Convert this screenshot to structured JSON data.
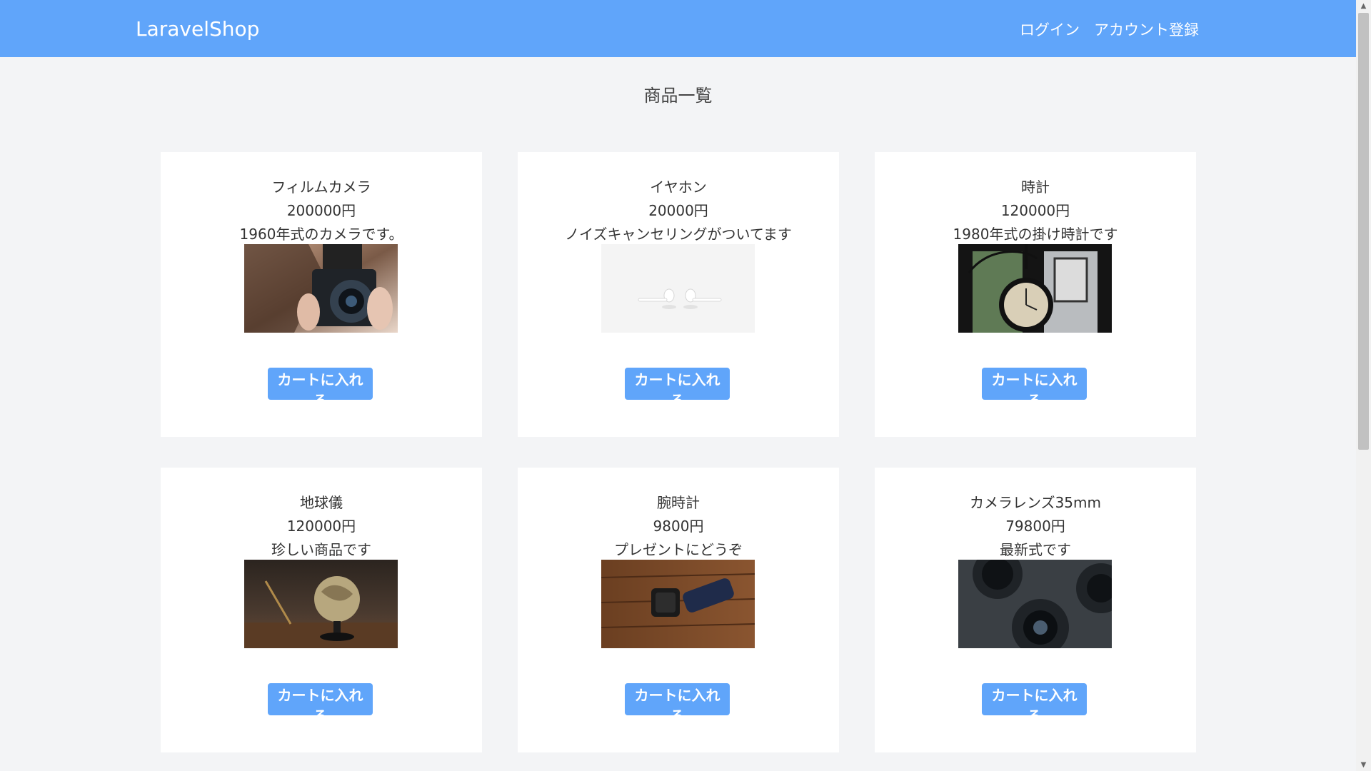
{
  "header": {
    "brand": "LaravelShop",
    "links": {
      "login": "ログイン",
      "register": "アカウント登録"
    }
  },
  "main": {
    "title": "商品一覧",
    "products": [
      {
        "name": "フィルムカメラ",
        "price": "200000円",
        "description": "1960年式のカメラです。",
        "image_icon": "film-camera-photo",
        "cart_label": "カートに入れる"
      },
      {
        "name": "イヤホン",
        "price": "20000円",
        "description": "ノイズキャンセリングがついてます",
        "image_icon": "earphones-photo",
        "cart_label": "カートに入れる"
      },
      {
        "name": "時計",
        "price": "120000円",
        "description": "1980年式の掛け時計です",
        "image_icon": "wall-clock-photo",
        "cart_label": "カートに入れる"
      },
      {
        "name": "地球儀",
        "price": "120000円",
        "description": "珍しい商品です",
        "image_icon": "globe-photo",
        "cart_label": "カートに入れる"
      },
      {
        "name": "腕時計",
        "price": "9800円",
        "description": "プレゼントにどうぞ",
        "image_icon": "wristwatch-photo",
        "cart_label": "カートに入れる"
      },
      {
        "name": "カメラレンズ35mm",
        "price": "79800円",
        "description": "最新式です",
        "image_icon": "camera-lens-photo",
        "cart_label": "カートに入れる"
      }
    ]
  },
  "colors": {
    "accent": "#60a5fa",
    "background": "#f3f4f6",
    "card": "#ffffff"
  }
}
